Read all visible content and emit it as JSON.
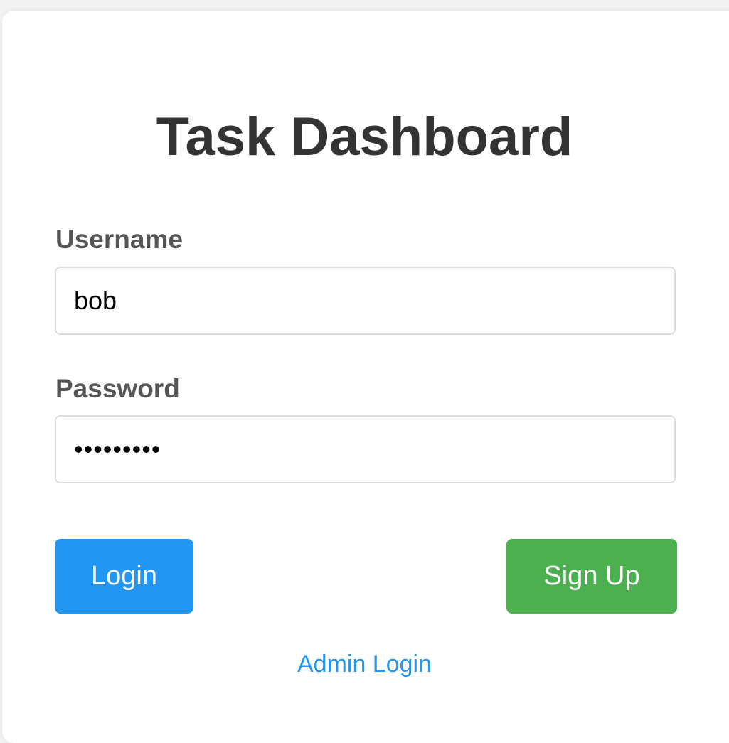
{
  "page": {
    "title": "Task Dashboard"
  },
  "form": {
    "username_label": "Username",
    "username_value": "bob",
    "password_label": "Password",
    "password_value": "•••••••••"
  },
  "actions": {
    "login_label": "Login",
    "signup_label": "Sign Up",
    "admin_link_label": "Admin Login"
  },
  "colors": {
    "primary": "#2196f3",
    "success": "#4caf50",
    "title_text": "#333333",
    "label_text": "#555555",
    "border": "#dddddd"
  }
}
